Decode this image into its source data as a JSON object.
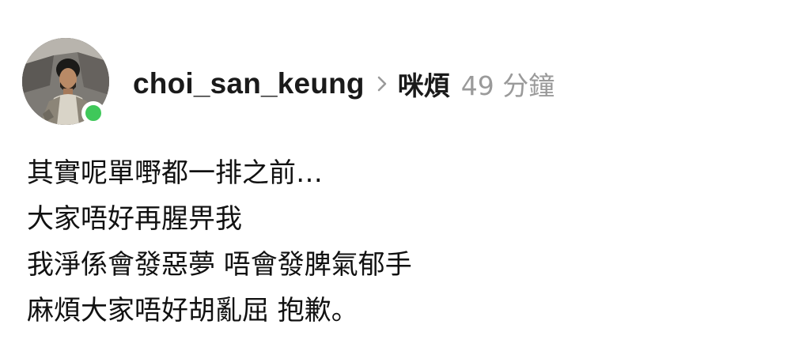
{
  "post": {
    "username": "choi_san_keung",
    "topic": "咪煩",
    "time": "49 分鐘",
    "lines": [
      "其實呢單嘢都一排之前…",
      "大家唔好再腥畀我",
      "我淨係會發惡夢 唔會發脾氣郁手",
      "麻煩大家唔好胡亂屈 抱歉。"
    ]
  },
  "colors": {
    "online": "#3fc85a",
    "muted": "#9a9a9a"
  },
  "icons": {
    "separator": "chevron-right-icon",
    "status": "online-status-icon"
  }
}
